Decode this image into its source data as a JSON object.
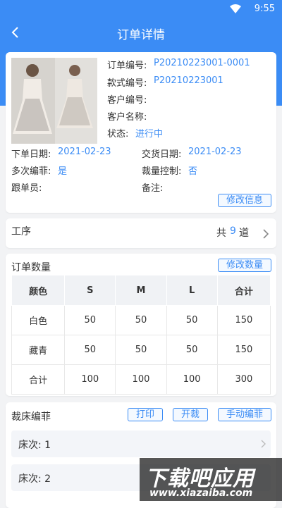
{
  "status_bar": {
    "time": "9:55"
  },
  "header": {
    "title": "订单详情",
    "back_icon": "chevron-left-icon"
  },
  "order": {
    "order_no_label": "订单编号:",
    "order_no": "P20210223001-0001",
    "style_no_label": "款式编号:",
    "style_no": "P20210223001",
    "customer_no_label": "客户编号:",
    "customer_no": "",
    "customer_name_label": "客户名称:",
    "customer_name": "",
    "status_label": "状态:",
    "status": "进行中",
    "order_date_label": "下单日期:",
    "order_date": "2021-02-23",
    "delivery_date_label": "交货日期:",
    "delivery_date": "2021-02-23",
    "multi_number_label": "多次编菲:",
    "multi_number": "是",
    "cut_control_label": "裁量控制:",
    "cut_control": "否",
    "follower_label": "跟单员:",
    "follower": "",
    "remark_label": "备注:",
    "remark": "",
    "edit_button": "修改信息"
  },
  "process": {
    "label": "工序",
    "count_prefix": "共",
    "count": "9",
    "count_suffix": "道"
  },
  "quantity": {
    "title": "订单数量",
    "edit_button": "修改数量",
    "headers": [
      "颜色",
      "S",
      "M",
      "L",
      "合计"
    ],
    "rows": [
      [
        "白色",
        "50",
        "50",
        "50",
        "150"
      ],
      [
        "藏青",
        "50",
        "50",
        "50",
        "150"
      ],
      [
        "合计",
        "100",
        "100",
        "100",
        "300"
      ]
    ]
  },
  "cutting": {
    "title": "裁床编菲",
    "buttons": [
      "打印",
      "开裁",
      "手动编菲"
    ],
    "beds": [
      "床次: 1",
      "床次: 2"
    ]
  },
  "watermark": {
    "text": "下载吧应用",
    "url": "www.xiazaiba.com"
  },
  "colors": {
    "primary": "#3b8cf5",
    "background": "#f2f3f5"
  }
}
